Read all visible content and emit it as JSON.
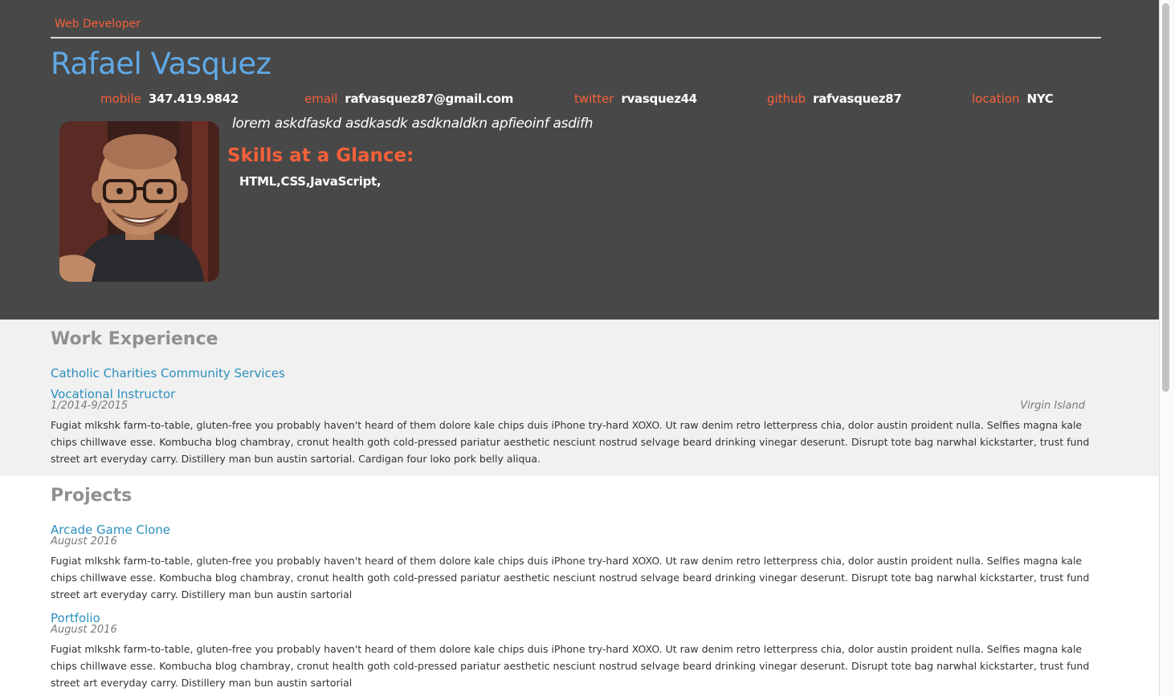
{
  "header": {
    "role": "Web Developer",
    "name": "Rafael Vasquez",
    "contacts": [
      {
        "label": "mobile",
        "value": "347.419.9842"
      },
      {
        "label": "email",
        "value": "rafvasquez87@gmail.com"
      },
      {
        "label": "twitter",
        "value": "rvasquez44"
      },
      {
        "label": "github",
        "value": "rafvasquez87"
      },
      {
        "label": "location",
        "value": "NYC"
      }
    ],
    "welcome": "lorem askdfaskd asdkasdk asdknaldkn apfieoinf asdifh",
    "skills_heading": "Skills at a Glance:",
    "skills": "HTML,CSS,JavaScript,"
  },
  "work": {
    "title": "Work Experience",
    "jobs": [
      {
        "employer": "Catholic Charities Community Services",
        "title": "Vocational Instructor",
        "dates": "1/2014-9/2015",
        "location": "Virgin Island",
        "description": "Fugiat mlkshk farm-to-table, gluten-free you probably haven't heard of them dolore kale chips duis iPhone try-hard XOXO. Ut raw denim retro letterpress chia, dolor austin proident nulla. Selfies magna kale chips chillwave esse. Kombucha blog chambray, cronut health goth cold-pressed pariatur aesthetic nesciunt nostrud selvage beard drinking vinegar deserunt. Disrupt tote bag narwhal kickstarter, trust fund street art everyday carry. Distillery man bun austin sartorial. Cardigan four loko pork belly aliqua."
      }
    ]
  },
  "projects": {
    "title": "Projects",
    "items": [
      {
        "title": "Arcade Game Clone",
        "dates": "August 2016",
        "description": "Fugiat mlkshk farm-to-table, gluten-free you probably haven't heard of them dolore kale chips duis iPhone try-hard XOXO. Ut raw denim retro letterpress chia, dolor austin proident nulla. Selfies magna kale chips chillwave esse. Kombucha blog chambray, cronut health goth cold-pressed pariatur aesthetic nesciunt nostrud selvage beard drinking vinegar deserunt. Disrupt tote bag narwhal kickstarter, trust fund street art everyday carry. Distillery man bun austin sartorial"
      },
      {
        "title": "Portfolio",
        "dates": "August 2016",
        "description": "Fugiat mlkshk farm-to-table, gluten-free you probably haven't heard of them dolore kale chips duis iPhone try-hard XOXO. Ut raw denim retro letterpress chia, dolor austin proident nulla. Selfies magna kale chips chillwave esse. Kombucha blog chambray, cronut health goth cold-pressed pariatur aesthetic nesciunt nostrud selvage beard drinking vinegar deserunt. Disrupt tote bag narwhal kickstarter, trust fund street art everyday carry. Distillery man bun austin sartorial"
      }
    ]
  },
  "colors": {
    "header_bg": "#484848",
    "accent_orange": "#f5603a",
    "name_blue": "#60a9e6",
    "link_blue": "#2b8fbd",
    "section_gray": "#909090"
  }
}
